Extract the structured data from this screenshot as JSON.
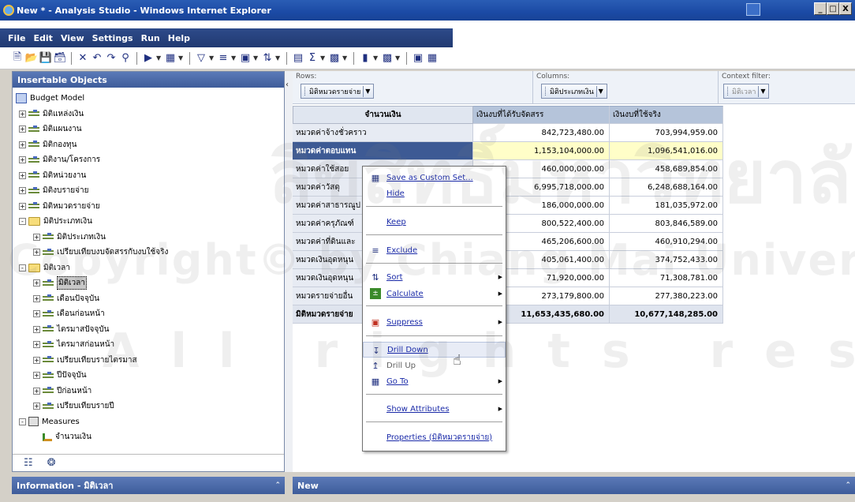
{
  "window": {
    "title": "New * - Analysis Studio - Windows Internet Explorer",
    "buttons": [
      "_",
      "□",
      "X"
    ]
  },
  "menubar": [
    "File",
    "Edit",
    "View",
    "Settings",
    "Run",
    "Help"
  ],
  "toolbar_icons": [
    "new-icon",
    "open-icon",
    "save-icon",
    "save-as-icon",
    "delete-icon",
    "undo-icon",
    "redo-icon",
    "find-icon",
    "run-icon",
    "insert-icon",
    "filter-icon",
    "sort-icon",
    "suppress-icon",
    "sort-az-icon",
    "chart-toggle-icon",
    "sum-icon",
    "calc-icon",
    "bar-chart-icon",
    "chart-type-icon",
    "explain-icon",
    "layout-icon"
  ],
  "left_panel": {
    "header": "Insertable Objects",
    "root": "Budget Model",
    "items": [
      {
        "label": "มิติแหล่งเงิน",
        "level": 1,
        "expander": "+",
        "icon": "dim"
      },
      {
        "label": "มิติแผนงาน",
        "level": 1,
        "expander": "+",
        "icon": "dim"
      },
      {
        "label": "มิติกองทุน",
        "level": 1,
        "expander": "+",
        "icon": "dim"
      },
      {
        "label": "มิติงาน/โครงการ",
        "level": 1,
        "expander": "+",
        "icon": "dim"
      },
      {
        "label": "มิติหน่วยงาน",
        "level": 1,
        "expander": "+",
        "icon": "dim"
      },
      {
        "label": "มิติงบรายจ่าย",
        "level": 1,
        "expander": "+",
        "icon": "dim"
      },
      {
        "label": "มิติหมวดรายจ่าย",
        "level": 1,
        "expander": "+",
        "icon": "dim"
      },
      {
        "label": "มิติประเภทเงิน",
        "level": 1,
        "expander": "-",
        "icon": "folder"
      },
      {
        "label": "มิติประเภทเงิน",
        "level": 2,
        "expander": "+",
        "icon": "dim"
      },
      {
        "label": "เปรียบเทียบงบจัดสรรกับงบใช้จริง",
        "level": 2,
        "expander": "+",
        "icon": "dim"
      },
      {
        "label": "มิติเวลา",
        "level": 1,
        "expander": "-",
        "icon": "folder"
      },
      {
        "label": "มิติเวลา",
        "level": 2,
        "expander": "+",
        "icon": "dim",
        "selected": true
      },
      {
        "label": "เดือนปัจจุบัน",
        "level": 2,
        "expander": "+",
        "icon": "dim"
      },
      {
        "label": "เดือนก่อนหน้า",
        "level": 2,
        "expander": "+",
        "icon": "dim"
      },
      {
        "label": "ไตรมาสปัจจุบัน",
        "level": 2,
        "expander": "+",
        "icon": "dim"
      },
      {
        "label": "ไตรมาสก่อนหน้า",
        "level": 2,
        "expander": "+",
        "icon": "dim"
      },
      {
        "label": "เปรียบเทียบรายไตรมาส",
        "level": 2,
        "expander": "+",
        "icon": "dim"
      },
      {
        "label": "ปีปัจจุบัน",
        "level": 2,
        "expander": "+",
        "icon": "dim"
      },
      {
        "label": "ปีก่อนหน้า",
        "level": 2,
        "expander": "+",
        "icon": "dim"
      },
      {
        "label": "เปรียบเทียบรายปี",
        "level": 2,
        "expander": "+",
        "icon": "dim"
      },
      {
        "label": "Measures",
        "level": 1,
        "expander": "-",
        "icon": "measures"
      },
      {
        "label": "จำนวนเงิน",
        "level": 2,
        "expander": "",
        "icon": "measure"
      }
    ]
  },
  "info_bar": {
    "title": "Information - มิติเวลา"
  },
  "new_bar": {
    "title": "New"
  },
  "dropzones": {
    "rows": {
      "label": "Rows:",
      "chip": "มิติหมวดรายจ่าย"
    },
    "columns": {
      "label": "Columns:",
      "chip": "มิติประเภทเงิน"
    },
    "context": {
      "label": "Context filter:",
      "chip": "มิติเวลา"
    }
  },
  "crosstab": {
    "corner": "จำนวนเงิน",
    "columns": [
      "เงินงบที่ได้รับจัดสรร",
      "เงินงบที่ใช้จริง"
    ],
    "rows": [
      {
        "label": "หมวดค่าจ้างชั่วคราว",
        "values": [
          "842,723,480.00",
          "703,994,959.00"
        ]
      },
      {
        "label": "หมวดค่าตอบแทน",
        "values": [
          "1,153,104,000.00",
          "1,096,541,016.00"
        ],
        "active": true
      },
      {
        "label": "หมวดค่าใช้สอย",
        "values": [
          "460,000,000.00",
          "458,689,854.00"
        ]
      },
      {
        "label": "หมวดค่าวัสดุ",
        "values": [
          "6,995,718,000.00",
          "6,248,688,164.00"
        ]
      },
      {
        "label": "หมวดค่าสาธารณูป",
        "values": [
          "186,000,000.00",
          "181,035,972.00"
        ]
      },
      {
        "label": "หมวดค่าครุภัณฑ์",
        "values": [
          "800,522,400.00",
          "803,846,589.00"
        ]
      },
      {
        "label": "หมวดค่าที่ดินและ",
        "values": [
          "465,206,600.00",
          "460,910,294.00"
        ]
      },
      {
        "label": "หมวดเงินอุดหนุน",
        "values": [
          "405,061,400.00",
          "374,752,433.00"
        ]
      },
      {
        "label": "หมวดเงินอุดหนุน",
        "values": [
          "71,920,000.00",
          "71,308,781.00"
        ]
      },
      {
        "label": "หมวดรายจ่ายอื่น",
        "values": [
          "273,179,800.00",
          "277,380,223.00"
        ]
      }
    ],
    "total": {
      "label": "มิติหมวดรายจ่าย",
      "values": [
        "11,653,435,680.00",
        "10,677,148,285.00"
      ]
    }
  },
  "context_menu": {
    "items": {
      "save_custom_set": "Save as Custom Set...",
      "hide": "Hide",
      "keep": "Keep",
      "exclude": "Exclude",
      "sort": "Sort",
      "calculate": "Calculate",
      "suppress": "Suppress",
      "drill_down": "Drill Down",
      "drill_up": "Drill Up",
      "go_to": "Go To",
      "show_attributes": "Show Attributes",
      "properties": "Properties (มิติหมวดรายจ่าย)"
    }
  },
  "watermark": {
    "line1": "ลิขสิทธิ์มหาวิทยาลัยเชียงใหม่",
    "line2": "Copyright© by Chiang Mai University",
    "line3": "All rights reserved"
  },
  "colors": {
    "title_bar": "#1b4aa5",
    "panel_header": "#4a68a8",
    "active_row": "#3d5a94",
    "highlight_cell": "#fffec8",
    "column_header": "#b5c4da",
    "link": "#1a2aa8"
  }
}
